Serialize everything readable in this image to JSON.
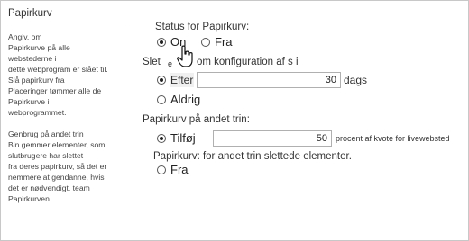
{
  "left": {
    "title": "Papirkurv",
    "desc1": [
      "Angiv, om",
      "Papirkurve på alle",
      "webstederne i",
      "dette webprogram er slået til.",
      "Slå papirkurv fra",
      "Placeringer tømmer alle de",
      "Papirkurve i",
      "webprogrammet."
    ],
    "desc2": [
      "Genbrug på andet trin",
      "Bin gemmer elementer, som",
      "slutbrugere har slettet",
      "fra deres papirkurv, så det er",
      "nemmere at gendanne, hvis",
      "det er nødvendigt. team",
      "Papirkurven."
    ]
  },
  "status": {
    "label": "Status for Papirkurv:",
    "on_label": "On",
    "off_label": "Fra",
    "selected": "on"
  },
  "delete": {
    "label_start": "Slet",
    "label_e": "e",
    "label_rest": "om konfiguration af s i",
    "after_label": "Efter",
    "after_value": "30",
    "unit": "dags",
    "never_label": "Aldrig",
    "selected": "after"
  },
  "second_stage": {
    "label": "Papirkurv på andet trin:",
    "add_label": "Tilføj",
    "value": "50",
    "unit": "procent af kvote for livewebsted"
  },
  "second_deleted": {
    "label": "Papirkurv: for andet trin slettede elementer.",
    "off_label": "Fra"
  },
  "colors": {
    "border": "#c8c8c8",
    "text": "#222222",
    "input_border": "#b0b0b0"
  },
  "icons": {
    "cursor": "hand-pointer-icon"
  }
}
